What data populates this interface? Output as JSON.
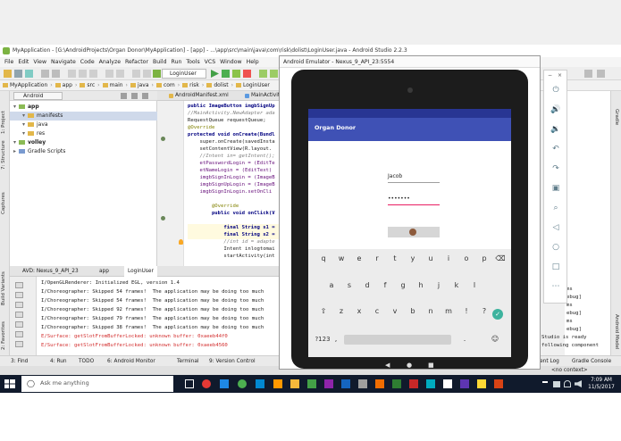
{
  "ide": {
    "window_title": "MyApplication - [G:\\AndroidProjects\\Organ Donor\\MyApplication] - [app] - ...\\app\\src\\main\\java\\com\\risk\\dolist\\LoginUser.java - Android Studio 2.2.3",
    "menu": [
      "File",
      "Edit",
      "View",
      "Navigate",
      "Code",
      "Analyze",
      "Refactor",
      "Build",
      "Run",
      "Tools",
      "VCS",
      "Window",
      "Help"
    ],
    "run_config": "LoginUser",
    "breadcrumbs": [
      "MyApplication",
      "app",
      "src",
      "main",
      "java",
      "com",
      "risk",
      "dolist",
      "LoginUser"
    ],
    "project_view": "Android",
    "tree": [
      {
        "label": "app",
        "level": 0,
        "kind": "module"
      },
      {
        "label": "manifests",
        "level": 1,
        "kind": "folder",
        "selected": true
      },
      {
        "label": "java",
        "level": 1,
        "kind": "folder"
      },
      {
        "label": "res",
        "level": 1,
        "kind": "folder"
      },
      {
        "label": "volley",
        "level": 0,
        "kind": "module"
      },
      {
        "label": "Gradle Scripts",
        "level": 0,
        "kind": "gradle"
      }
    ],
    "left_tabs": [
      "1: Project",
      "7: Structure",
      "Captures",
      "Build Variants",
      "2: Favorites"
    ],
    "editor_tabs": [
      "AndroidManifest.xml",
      "MainActivity"
    ],
    "code_lines": [
      {
        "text": "public ImageButton imgbSignUp",
        "style": "kw"
      },
      {
        "text": "//MainActivity.NewAdapter ada",
        "style": "cm"
      },
      {
        "text": "RequestQueue requestQueue;",
        "style": ""
      },
      {
        "text": "@Override",
        "style": "ann"
      },
      {
        "text": "protected void onCreate(Bundl",
        "style": "kw"
      },
      {
        "text": "    super.onCreate(savedInsta",
        "style": ""
      },
      {
        "text": "    setContentView(R.layout.",
        "style": ""
      },
      {
        "text": "    //Intent in= getIntent();",
        "style": "cm"
      },
      {
        "text": "    etPasswordLogin = (EditTe",
        "style": "fld"
      },
      {
        "text": "    etNameLogin = (EditText) ",
        "style": "fld"
      },
      {
        "text": "    imgbSignInLogin = (ImageB",
        "style": "fld"
      },
      {
        "text": "    imgbSignUpLogin = (ImageB",
        "style": "fld"
      },
      {
        "text": "    imgbSignInLogin.setOnCli",
        "style": "fld"
      },
      {
        "text": "",
        "style": ""
      },
      {
        "text": "        @Override",
        "style": "ann"
      },
      {
        "text": "        public void onClick(V",
        "style": "kw"
      },
      {
        "text": "",
        "style": ""
      },
      {
        "text": "            final String s1 =",
        "style": "kw"
      },
      {
        "text": "            final String s2 =",
        "style": "kw"
      },
      {
        "text": "            //int id = adapte",
        "style": "cm"
      },
      {
        "text": "            Intent inlogtomai",
        "style": ""
      },
      {
        "text": "            startActivity(int",
        "style": ""
      }
    ],
    "bottom_tabs": [
      "AVD: Nexus_9_API_23",
      "app",
      "LoginUser"
    ],
    "log_lines": [
      {
        "text": "I/OpenGLRenderer: Initialized EGL, version 1.4",
        "error": false
      },
      {
        "text": "I/Choreographer: Skipped 54 frames!  The application may be doing too much",
        "error": false
      },
      {
        "text": "I/Choreographer: Skipped 54 frames!  The application may be doing too much",
        "error": false
      },
      {
        "text": "I/Choreographer: Skipped 92 frames!  The application may be doing too much",
        "error": false
      },
      {
        "text": "I/Choreographer: Skipped 79 frames!  The application may be doing too much",
        "error": false
      },
      {
        "text": "I/Choreographer: Skipped 38 frames!  The application may be doing too much",
        "error": false
      },
      {
        "text": "E/Surface: getSlotFromBufferLocked: unknown buffer: 0xaeeb44f0",
        "error": true
      },
      {
        "text": "E/Surface: getSlotFromBufferLocked: unknown buffer: 0xaeeb4560",
        "error": true
      }
    ],
    "status_items": [
      "3: Find",
      "4: Run",
      "TODO",
      "6: Android Monitor",
      "Terminal",
      "9: Version Control"
    ],
    "right_panel_lines": [
      "ms",
      "ebug]",
      "ms",
      "ebug]",
      "ms",
      "ebug]",
      "Studio is ready",
      "following component"
    ],
    "right_tabs": [
      "Gradle",
      "Android Model"
    ],
    "right_status": [
      "Event Log",
      "Gradle Console"
    ],
    "right_status_context": "<no context>"
  },
  "emulator": {
    "window_title": "Android Emulator - Nexus_9_API_23:5554",
    "app_title": "Organ Donor",
    "username_value": "Jacob",
    "password_value": "•••••••",
    "keyboard_rows": [
      [
        "q",
        "w",
        "e",
        "r",
        "t",
        "y",
        "u",
        "i",
        "o",
        "p"
      ],
      [
        "a",
        "s",
        "d",
        "f",
        "g",
        "h",
        "j",
        "k",
        "l"
      ],
      [
        "⇧",
        "z",
        "x",
        "c",
        "v",
        "b",
        "n",
        "m",
        "!",
        "?"
      ]
    ],
    "backspace": "⌫",
    "enter": "✓",
    "sym_key": "?123",
    "comma_key": ",",
    "period_key": ".",
    "emoji_key": "☺",
    "nav": [
      "◀",
      "●",
      "■"
    ],
    "side_icons": [
      "power-icon",
      "volume-up-icon",
      "volume-down-icon",
      "rotate-left-icon",
      "rotate-right-icon",
      "camera-icon",
      "zoom-icon",
      "back-icon",
      "home-icon",
      "overview-icon",
      "more-icon"
    ],
    "side_symbols": [
      "⏻",
      "🔊",
      "🔉",
      "↶",
      "↷",
      "▣",
      "⌕",
      "◁",
      "○",
      "□",
      "⋯"
    ],
    "side_controls": [
      "−",
      "×"
    ]
  },
  "taskbar": {
    "search_placeholder": "Ask me anything",
    "time": "7:09 AM",
    "date": "11/5/2017"
  }
}
